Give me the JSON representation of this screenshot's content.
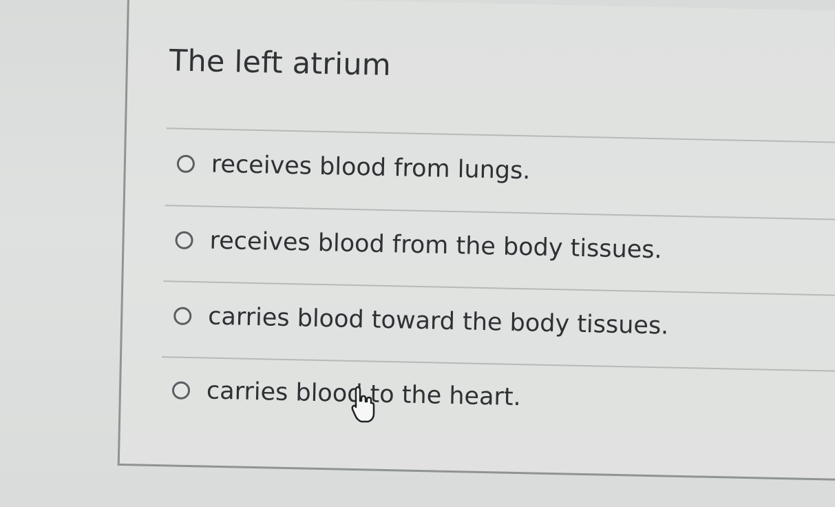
{
  "question": {
    "text": "The left atrium"
  },
  "options": [
    {
      "label": "receives blood from lungs.",
      "selected": false
    },
    {
      "label": "receives blood from the body tissues.",
      "selected": false
    },
    {
      "label": "carries blood toward the body tissues.",
      "selected": false
    },
    {
      "label": "carries blood to the heart.",
      "selected": false
    }
  ],
  "cursor": {
    "icon": "hand-pointer-icon"
  }
}
